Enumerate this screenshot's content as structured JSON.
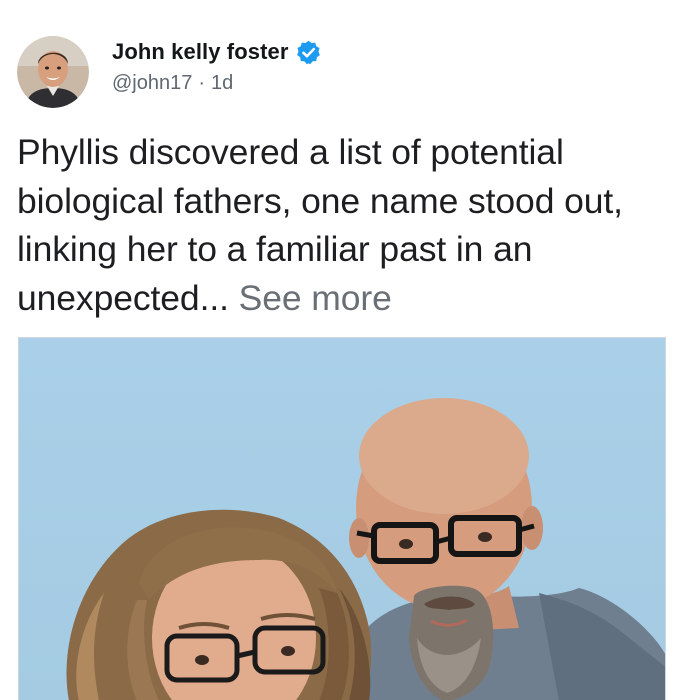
{
  "post": {
    "author": {
      "name": "John kelly foster",
      "handle": "@john17",
      "time": "1d",
      "separator": "·",
      "verified": true,
      "avatar_icon": "profile-photo"
    },
    "text": "Phyllis discovered a list of potential biological fathers, one name stood out, linking her to a familiar past in an unexpected...",
    "see_more_label": "See more",
    "image": {
      "subject": "photo-of-couple"
    }
  },
  "colors": {
    "verified_badge": "#1d9bf0",
    "text": "#1c1e21",
    "muted": "#606770",
    "sky": "#a8cfe6"
  }
}
